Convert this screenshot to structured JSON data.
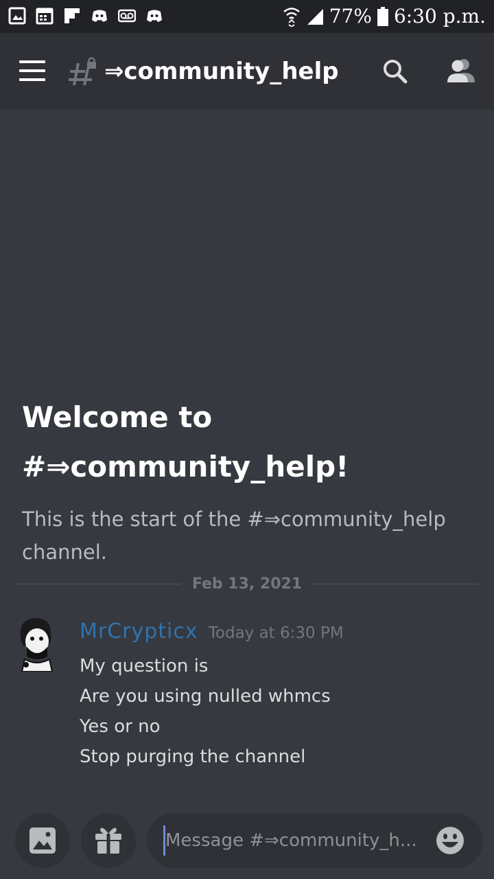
{
  "status_bar": {
    "battery_percent": "77%",
    "time": "6:30 p.m.",
    "notification_icons": [
      "gallery-icon",
      "calendar-icon",
      "flipboard-icon",
      "discord-icon",
      "voicemail-icon",
      "discord-icon"
    ],
    "system_icons": [
      "wifi-icon",
      "signal-icon",
      "battery-icon"
    ]
  },
  "header": {
    "channel_name": "⇒community_help",
    "icons": [
      "menu-icon",
      "locked-channel-icon",
      "search-icon",
      "members-icon"
    ]
  },
  "welcome": {
    "title": "Welcome to #⇒community_help!",
    "subtitle": "This is the start of the #⇒community_help channel."
  },
  "divider": {
    "date": "Feb 13, 2021"
  },
  "message": {
    "author": "MrCrypticx",
    "timestamp": "Today at 6:30 PM",
    "author_color": "#2f73b0",
    "lines": [
      "My question is",
      "Are you using nulled whmcs",
      "Yes or no",
      "Stop purging the channel"
    ]
  },
  "composer": {
    "placeholder": "Message #⇒community_h...",
    "value": "",
    "buttons": [
      "image-upload-icon",
      "gift-icon",
      "emoji-icon"
    ]
  },
  "colors": {
    "background": "#36393f",
    "header": "#2f3136",
    "status_bar": "#202225",
    "accent": "#7289da"
  }
}
